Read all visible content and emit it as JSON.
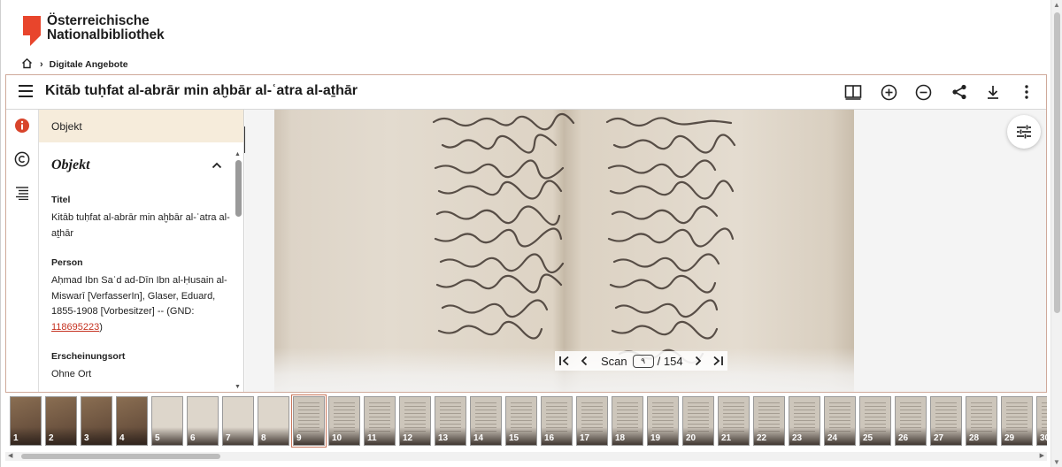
{
  "brand": {
    "line1": "Österreichische",
    "line2": "Nationalbibliothek",
    "accent": "#e8452c"
  },
  "breadcrumb": {
    "current": "Digitale Angebote"
  },
  "viewer": {
    "title": "Kitāb tuḥfat al-abrār min aḫbār al-ʿatra al-aṯhār",
    "panel_tab": "Objekt",
    "section_title": "Objekt",
    "fields": {
      "titel_label": "Titel",
      "titel_value": "Kitāb tuḥfat al-abrār min aḫbār al-ʿatra al-aṯhār",
      "person_label": "Person",
      "person_value": "Aḥmad Ibn Saʿd ad-Dīn Ibn al-Ḥusain al-Miswarī [VerfasserIn], Glaser, Eduard, 1855-1908 [Vorbesitzer] -- (GND: ",
      "person_gnd": "118695223",
      "person_close": ")",
      "ort_label": "Erscheinungsort",
      "ort_value": "Ohne Ort"
    },
    "pager": {
      "label": "Scan",
      "current": "٩",
      "total": "/ 154"
    }
  },
  "thumbnails": [
    {
      "n": "1",
      "kind": "cover"
    },
    {
      "n": "2",
      "kind": "cover"
    },
    {
      "n": "3",
      "kind": "cover"
    },
    {
      "n": "4",
      "kind": "cover"
    },
    {
      "n": "5",
      "kind": "blank"
    },
    {
      "n": "6",
      "kind": "blank"
    },
    {
      "n": "7",
      "kind": "blank"
    },
    {
      "n": "8",
      "kind": "blank"
    },
    {
      "n": "9",
      "kind": "text",
      "selected": true
    },
    {
      "n": "10",
      "kind": "text"
    },
    {
      "n": "11",
      "kind": "text"
    },
    {
      "n": "12",
      "kind": "text"
    },
    {
      "n": "13",
      "kind": "text"
    },
    {
      "n": "14",
      "kind": "text"
    },
    {
      "n": "15",
      "kind": "text"
    },
    {
      "n": "16",
      "kind": "text"
    },
    {
      "n": "17",
      "kind": "text"
    },
    {
      "n": "18",
      "kind": "text"
    },
    {
      "n": "19",
      "kind": "text"
    },
    {
      "n": "20",
      "kind": "text"
    },
    {
      "n": "21",
      "kind": "text"
    },
    {
      "n": "22",
      "kind": "text"
    },
    {
      "n": "23",
      "kind": "text"
    },
    {
      "n": "24",
      "kind": "text"
    },
    {
      "n": "25",
      "kind": "text"
    },
    {
      "n": "26",
      "kind": "text"
    },
    {
      "n": "27",
      "kind": "text"
    },
    {
      "n": "28",
      "kind": "text"
    },
    {
      "n": "29",
      "kind": "text"
    },
    {
      "n": "30",
      "kind": "text"
    }
  ]
}
